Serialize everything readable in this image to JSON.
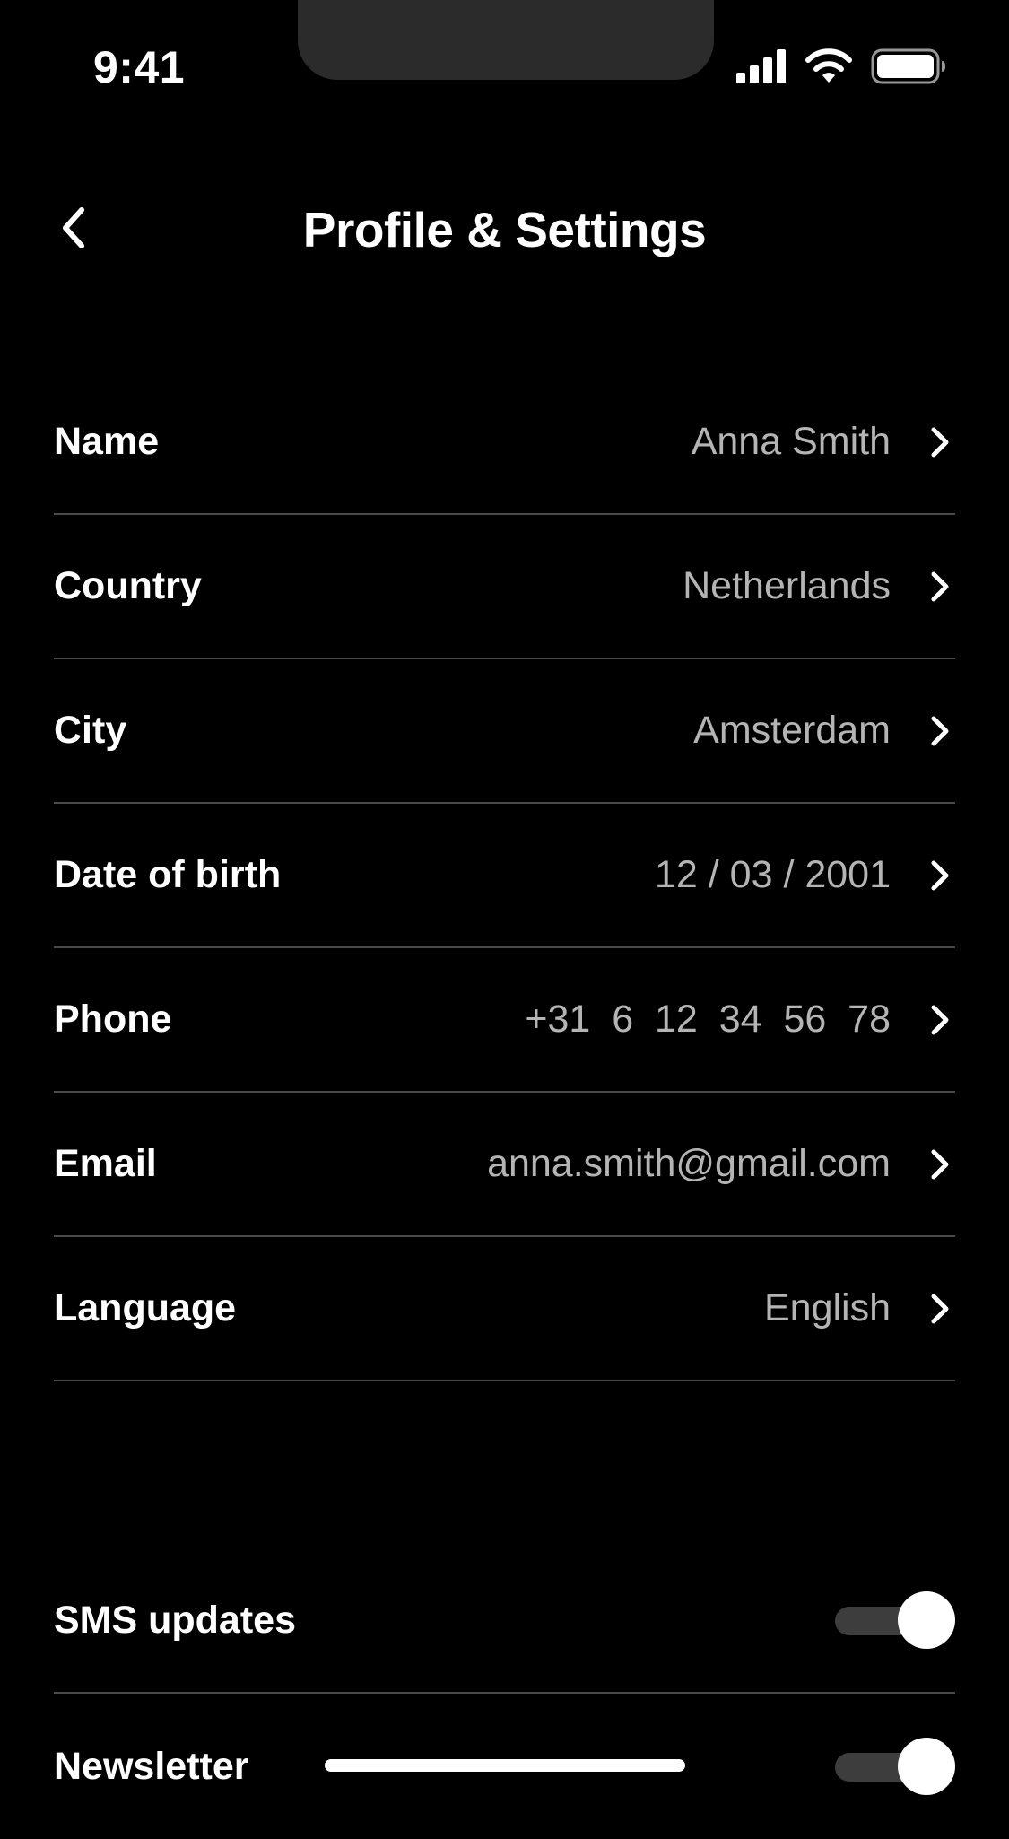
{
  "status_bar": {
    "time": "9:41",
    "icons": [
      "cellular-signal-icon",
      "wifi-icon",
      "battery-icon"
    ]
  },
  "header": {
    "back_icon": "chevron-left-icon",
    "title": "Profile & Settings"
  },
  "settings": [
    {
      "label": "Name",
      "value": "Anna Smith"
    },
    {
      "label": "Country",
      "value": "Netherlands"
    },
    {
      "label": "City",
      "value": "Amsterdam"
    },
    {
      "label": "Date of birth",
      "value": "12 / 03 / 2001"
    },
    {
      "label": "Phone",
      "value": "+31  6  12  34  56  78"
    },
    {
      "label": "Email",
      "value": "anna.smith@gmail.com"
    },
    {
      "label": "Language",
      "value": "English"
    }
  ],
  "toggles": [
    {
      "label": "SMS updates",
      "on": true
    },
    {
      "label": "Newsletter",
      "on": true
    }
  ],
  "colors": {
    "background": "#000000",
    "text_primary": "#ffffff",
    "text_secondary": "#b4b4b4",
    "divider": "#4a4a4a",
    "toggle_track": "#3d3d3d"
  }
}
